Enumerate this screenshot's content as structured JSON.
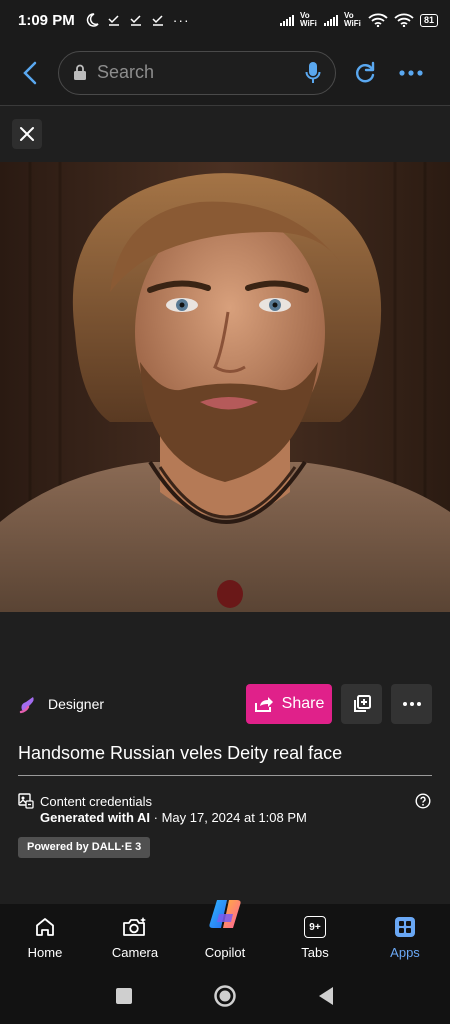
{
  "status_bar": {
    "time": "1:09 PM",
    "network_label_1": "Vo WiFi",
    "network_label_2": "Vo WiFi",
    "battery": "81"
  },
  "browser": {
    "search_placeholder": "Search"
  },
  "image": {
    "alt": "Handsome Russian veles Deity real face"
  },
  "designer": {
    "label": "Designer",
    "share_label": "Share"
  },
  "prompt": {
    "title": "Handsome Russian veles Deity real face"
  },
  "credentials": {
    "label": "Content credentials",
    "generated_bold": "Generated with AI",
    "generated_rest": " · May 17, 2024 at 1:08 PM",
    "powered_by": "Powered by DALL·E 3"
  },
  "bottom_nav": {
    "items": [
      {
        "label": "Home",
        "icon": "home-icon"
      },
      {
        "label": "Camera",
        "icon": "camera-icon"
      },
      {
        "label": "Copilot",
        "icon": "copilot-icon"
      },
      {
        "label": "Tabs",
        "icon": "tabs-icon",
        "badge": "9+"
      },
      {
        "label": "Apps",
        "icon": "apps-icon",
        "active": true
      }
    ]
  },
  "colors": {
    "accent_blue": "#5aa8f0",
    "share_pink": "#e0218a",
    "background": "#1f1f1f"
  }
}
